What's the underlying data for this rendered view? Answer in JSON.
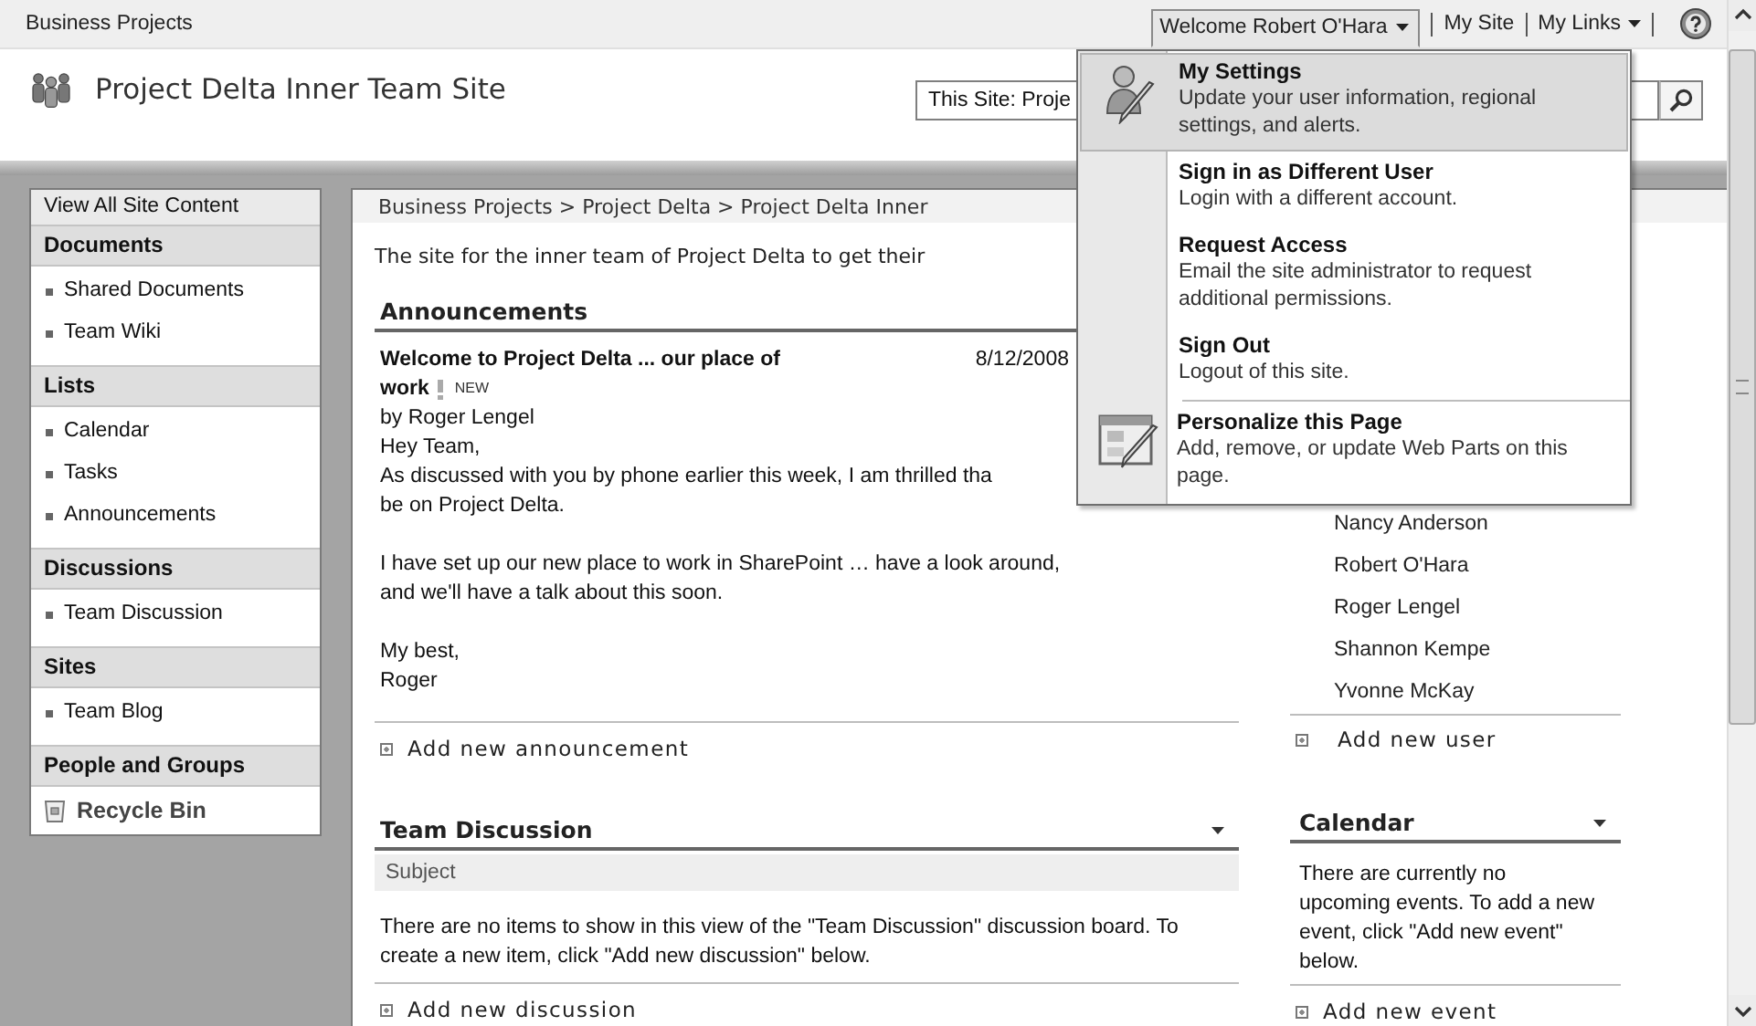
{
  "top_bar": {
    "site_link": "Business Projects",
    "welcome": {
      "label": "Welcome Robert O'Hara",
      "expanded": true
    },
    "links": [
      "My Site",
      "My Links"
    ]
  },
  "site_title": "Project Delta Inner Team Site",
  "search": {
    "scope": "This Site: Proje"
  },
  "nav": {
    "view_all": "View All Site Content",
    "sections": [
      {
        "heading": "Documents",
        "items": [
          "Shared Documents",
          "Team Wiki"
        ]
      },
      {
        "heading": "Lists",
        "items": [
          "Calendar",
          "Tasks",
          "Announcements"
        ]
      },
      {
        "heading": "Discussions",
        "items": [
          "Team Discussion"
        ]
      },
      {
        "heading": "Sites",
        "items": [
          "Team Blog"
        ]
      },
      {
        "heading": "People and Groups"
      }
    ],
    "recycle_bin": "Recycle Bin"
  },
  "breadcrumb": "Business Projects > Project Delta > Project Delta Inner",
  "description": "The site for the inner team of Project Delta to get their",
  "announcements": {
    "title": "Announcements",
    "item": {
      "title_lines": [
        "Welcome to Project Delta ... our place of",
        "work"
      ],
      "new_badge": "NEW",
      "date": "8/12/2008",
      "author": "by Roger Lengel",
      "paragraphs": [
        [
          "Hey Team,",
          "As discussed with you by phone earlier this week, I am thrilled tha",
          "be on Project Delta."
        ],
        [
          "I have set up our new place to work in SharePoint … have a look around,",
          "and we'll have a talk about this soon."
        ],
        [
          "My best,",
          "Roger"
        ]
      ]
    },
    "add_link": "Add new announcement"
  },
  "team_discussion": {
    "title": "Team Discussion",
    "column": "Subject",
    "empty_message": "There are no items to show in this view of the \"Team Discussion\" discussion board. To create a new item, click \"Add new discussion\" below.",
    "add_link": "Add new discussion"
  },
  "members": {
    "names": [
      "Nancy Anderson",
      "Robert O'Hara",
      "Roger Lengel",
      "Shannon Kempe",
      "Yvonne McKay"
    ],
    "add_link": "Add new user"
  },
  "calendar": {
    "title": "Calendar",
    "message": "There are currently no upcoming events. To add a new event, click \"Add new event\" below.",
    "add_link": "Add new event"
  },
  "user_menu": {
    "groups": [
      {
        "items": [
          {
            "kind": "person",
            "title": "My Settings",
            "description": "Update your user information, regional settings, and alerts.",
            "selected": true
          }
        ]
      },
      {
        "items": [
          {
            "kind": "plain",
            "title": "Sign in as Different User",
            "description": "Login with a different account.",
            "selected": false
          },
          {
            "kind": "plain",
            "title": "Request Access",
            "description": "Email the site administrator to request additional permissions.",
            "selected": false
          },
          {
            "kind": "plain",
            "title": "Sign Out",
            "description": "Logout of this site.",
            "selected": false
          }
        ]
      },
      {
        "items": [
          {
            "kind": "page",
            "title": "Personalize this Page",
            "description": "Add, remove, or update Web Parts on this page.",
            "selected": false
          }
        ]
      }
    ]
  }
}
